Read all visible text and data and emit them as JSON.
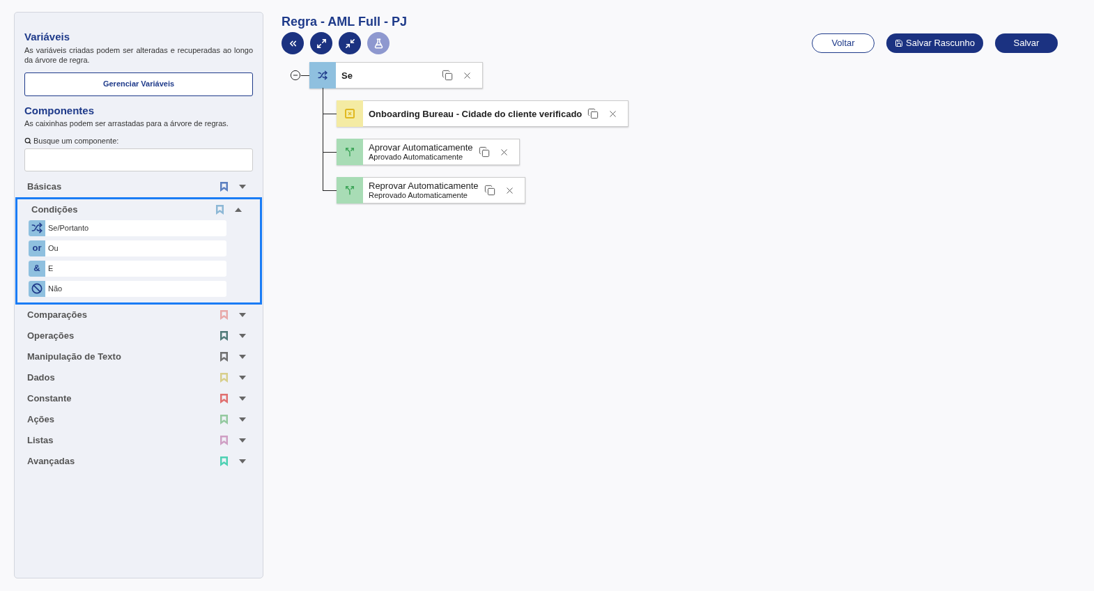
{
  "sidebar": {
    "variables": {
      "title": "Variáveis",
      "description": "As variáveis criadas podem ser alteradas e recuperadas ao longo da árvore de regra.",
      "button": "Gerenciar Variáveis"
    },
    "components": {
      "title": "Componentes",
      "description": "As caixinhas podem ser arrastadas para a árvore de regras.",
      "search_label": "Busque um componente:"
    },
    "categories": [
      {
        "label": "Básicas",
        "color": "#5b7fc0",
        "expanded": false
      },
      {
        "label": "Condições",
        "color": "#8db8d6",
        "expanded": true,
        "items": [
          {
            "kind": "shuffle",
            "label": "Se/Portanto"
          },
          {
            "kind": "text",
            "icon_text": "or",
            "label": "Ou"
          },
          {
            "kind": "text",
            "icon_text": "&",
            "label": "E"
          },
          {
            "kind": "ban",
            "label": "Não"
          }
        ]
      },
      {
        "label": "Comparações",
        "color": "#e8a9a9",
        "expanded": false
      },
      {
        "label": "Operações",
        "color": "#4f7a78",
        "expanded": false
      },
      {
        "label": "Manipulação de Texto",
        "color": "#707070",
        "expanded": false
      },
      {
        "label": "Dados",
        "color": "#d8cf8c",
        "expanded": false
      },
      {
        "label": "Constante",
        "color": "#e07070",
        "expanded": false
      },
      {
        "label": "Ações",
        "color": "#94c9a0",
        "expanded": false
      },
      {
        "label": "Listas",
        "color": "#cf9fc4",
        "expanded": false
      },
      {
        "label": "Avançadas",
        "color": "#4fd1b4",
        "expanded": false
      }
    ]
  },
  "header": {
    "title": "Regra - AML Full - PJ",
    "tools": [
      {
        "kind": "collapse",
        "disabled": false
      },
      {
        "kind": "expand",
        "disabled": false
      },
      {
        "kind": "shrink",
        "disabled": false
      },
      {
        "kind": "test",
        "disabled": true
      }
    ],
    "buttons": [
      {
        "kind": "outline",
        "label": "Voltar"
      },
      {
        "kind": "draft",
        "label": "Salvar Rascunho"
      },
      {
        "kind": "solid",
        "label": "Salvar"
      }
    ]
  },
  "tree": {
    "kind": "condition",
    "title": "Se",
    "expanded": true,
    "children": [
      {
        "kind": "variable",
        "title": "Onboarding Bureau - Cidade do cliente verificado"
      },
      {
        "kind": "action",
        "title": "Aprovar Automaticamente",
        "subtitle": "Aprovado Automaticamente"
      },
      {
        "kind": "action",
        "title": "Reprovar Automaticamente",
        "subtitle": "Reprovado Automaticamente"
      }
    ]
  }
}
